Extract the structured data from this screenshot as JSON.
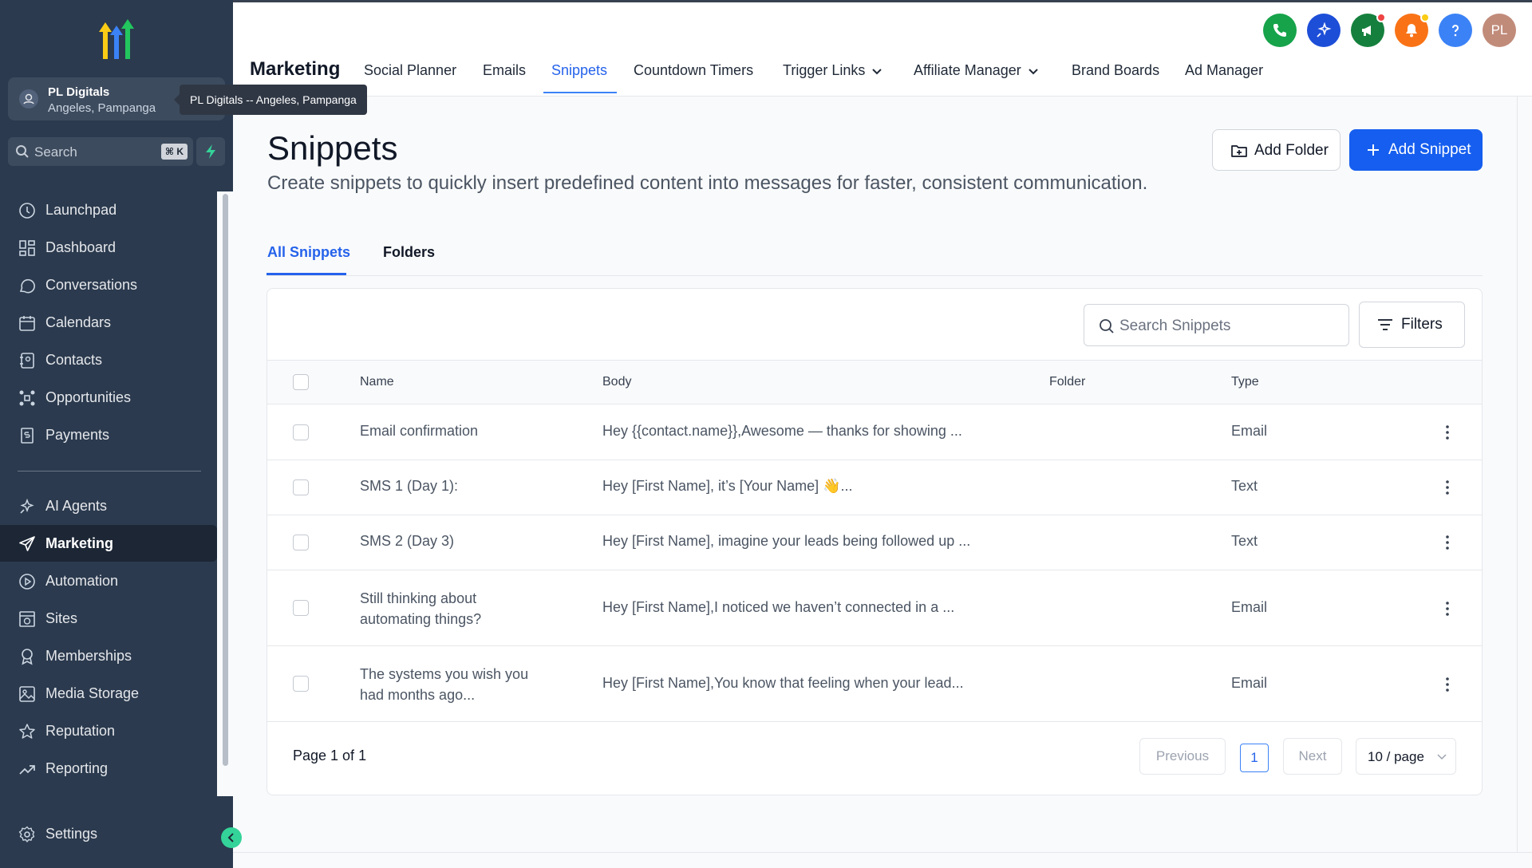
{
  "sidebar": {
    "location": {
      "name": "PL Digitals",
      "city": "Angeles, Pampanga",
      "tooltip": "PL Digitals -- Angeles, Pampanga"
    },
    "search": {
      "placeholder": "Search",
      "shortcut": "⌘ K"
    },
    "nav_top": [
      {
        "label": "Launchpad",
        "icon": "launchpad-icon"
      },
      {
        "label": "Dashboard",
        "icon": "dashboard-icon"
      },
      {
        "label": "Conversations",
        "icon": "chat-icon"
      },
      {
        "label": "Calendars",
        "icon": "calendar-icon"
      },
      {
        "label": "Contacts",
        "icon": "contacts-icon"
      },
      {
        "label": "Opportunities",
        "icon": "opportunities-icon"
      },
      {
        "label": "Payments",
        "icon": "payments-icon"
      }
    ],
    "nav_bottom": [
      {
        "label": "AI Agents",
        "icon": "ai-agents-icon"
      },
      {
        "label": "Marketing",
        "icon": "send-icon",
        "active": true
      },
      {
        "label": "Automation",
        "icon": "automation-icon"
      },
      {
        "label": "Sites",
        "icon": "sites-icon"
      },
      {
        "label": "Memberships",
        "icon": "memberships-icon"
      },
      {
        "label": "Media Storage",
        "icon": "media-icon"
      },
      {
        "label": "Reputation",
        "icon": "star-icon"
      },
      {
        "label": "Reporting",
        "icon": "reporting-icon"
      }
    ],
    "settings_label": "Settings"
  },
  "header": {
    "title": "Marketing",
    "tabs": [
      "Social Planner",
      "Emails",
      "Snippets",
      "Countdown Timers",
      "Trigger Links",
      "Affiliate Manager",
      "Brand Boards",
      "Ad Manager"
    ],
    "active_tab": "Snippets",
    "avatar_initials": "PL",
    "colors": {
      "phone": "#16a34a",
      "ai": "#1d4ed8",
      "announce": "#15803d",
      "bell": "#f97316",
      "help": "#3b82f6"
    }
  },
  "page": {
    "title": "Snippets",
    "description": "Create snippets to quickly insert predefined content into messages for faster, consistent communication.",
    "add_folder_label": "Add Folder",
    "add_snippet_label": "Add Snippet",
    "subtabs": [
      "All Snippets",
      "Folders"
    ],
    "search_placeholder": "Search Snippets",
    "filters_label": "Filters"
  },
  "table": {
    "columns": [
      "Name",
      "Body",
      "Folder",
      "Type"
    ],
    "rows": [
      {
        "name": "Email confirmation",
        "body": "Hey {{contact.name}},Awesome — thanks for showing ...",
        "folder": "",
        "type": "Email"
      },
      {
        "name": "SMS 1 (Day 1):",
        "body": "Hey [First Name], it’s [Your Name] 👋...",
        "folder": "",
        "type": "Text"
      },
      {
        "name": "SMS 2 (Day 3)",
        "body": "Hey [First Name], imagine your leads being followed up ...",
        "folder": "",
        "type": "Text"
      },
      {
        "name": "Still thinking about automating things?",
        "body": "Hey [First Name],I noticed we haven’t connected in a ...",
        "folder": "",
        "type": "Email"
      },
      {
        "name": "The systems you wish you had months ago...",
        "body": "Hey [First Name],You know that feeling when your lead...",
        "folder": "",
        "type": "Email"
      }
    ]
  },
  "pagination": {
    "text": "Page 1 of 1",
    "previous": "Previous",
    "next": "Next",
    "current": "1",
    "page_size": "10 / page"
  },
  "colors": {
    "sidebar_bg": "#2b3a4e",
    "accent": "#155eef"
  }
}
